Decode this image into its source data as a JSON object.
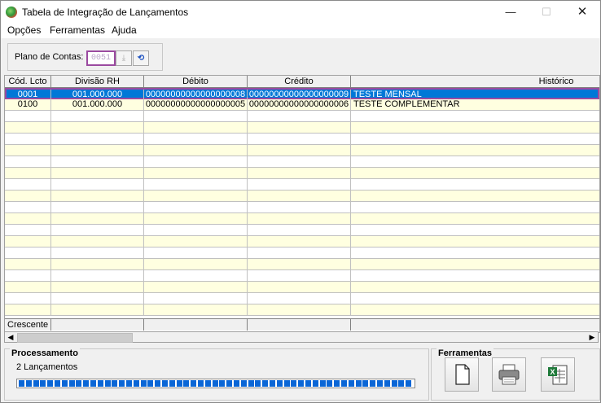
{
  "window": {
    "title": "Tabela de Integração de Lançamentos",
    "controls": {
      "minimize": "—",
      "maximize": "☐",
      "close": "✕"
    }
  },
  "menu": [
    "Opções",
    "Ferramentas",
    "Ajuda"
  ],
  "plano": {
    "label": "Plano de Contas:",
    "value": "0051"
  },
  "table": {
    "columns": [
      "Cód. Lcto",
      "Divisão RH",
      "Débito",
      "Crédito",
      "Histórico"
    ],
    "rows": [
      {
        "cod": "0001",
        "divisao": "001.000.000",
        "debito": "00000000000000000008",
        "credito": "00000000000000000009",
        "historico": "TESTE MENSAL"
      },
      {
        "cod": "0100",
        "divisao": "001.000.000",
        "debito": "00000000000000000005",
        "credito": "00000000000000000006",
        "historico": "TESTE COMPLEMENTAR"
      }
    ],
    "footer_label": "Crescente"
  },
  "processamento": {
    "title": "Processamento",
    "status": "2 Lançamentos",
    "progress": 1.0
  },
  "ferramentas": {
    "title": "Ferramentas",
    "buttons": [
      "new-document-icon",
      "printer-icon",
      "excel-export-icon"
    ]
  },
  "colors": {
    "selection": "#0078d7",
    "alt_row": "#ffffe0",
    "highlight_border": "#9b4aa0",
    "progress": "#0a66d6"
  }
}
